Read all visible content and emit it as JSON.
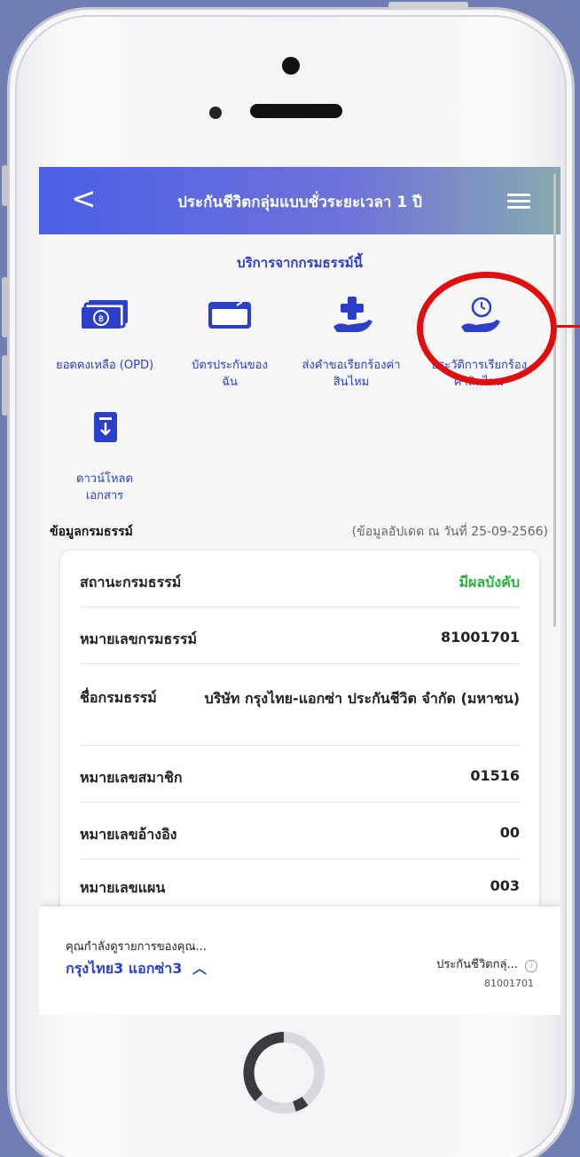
{
  "header": {
    "title": "ประกันชีวิตกลุ่มแบบชั่วระยะเวลา 1 ปี",
    "back_glyph": "<"
  },
  "services": {
    "heading": "บริการจากกรมธรรม์นี้",
    "items": [
      {
        "label": "ยอดคงเหลือ (OPD)",
        "icon": "money-icon"
      },
      {
        "label": "บัตรประกันของฉัน",
        "icon": "card-icon"
      },
      {
        "label": "ส่งคำขอเรียกร้องค่าสินไหม",
        "icon": "claim-hand-icon"
      },
      {
        "label": "ประวัติการเรียกร้องค่าสินไหม",
        "icon": "claim-history-icon"
      },
      {
        "label": "ดาวน์โหลดเอกสาร",
        "icon": "download-document-icon"
      }
    ]
  },
  "policy_info": {
    "label": "ข้อมูลกรมธรรม์",
    "updated": "(ข้อมูลอัปเดต ณ วันที่ 25-09-2566)",
    "rows": [
      {
        "key": "สถานะกรมธรรม์",
        "value": "มีผลบังคับ"
      },
      {
        "key": "หมายเลขกรมธรรม์",
        "value": "81001701"
      },
      {
        "key": "ชื่อกรมธรรม์",
        "value": "บริษัท กรุงไทย-แอกซ่า ประกันชีวิต จำกัด (มหาชน)"
      },
      {
        "key": "หมายเลขสมาชิก",
        "value": "01516"
      },
      {
        "key": "หมายเลขอ้างอิง",
        "value": "00"
      },
      {
        "key": "หมายเลขแผน",
        "value": "003"
      }
    ]
  },
  "bottom_bar": {
    "viewing_text": "คุณกำลังดูรายการของคุณ...",
    "owner_name": "กรุงไทย3 แอกซ่า3",
    "policy_name": "ประกันชีวิตกลุ่...",
    "policy_number": "81001701"
  },
  "colors": {
    "accent": "#2c3fc8",
    "active_status": "#27b43a",
    "highlight": "#e10e0e"
  }
}
